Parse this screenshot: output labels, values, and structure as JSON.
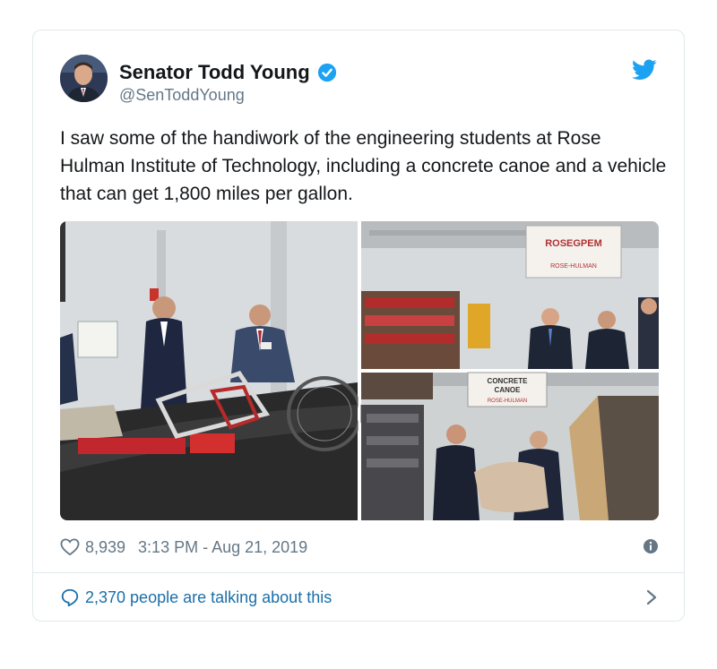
{
  "author": {
    "name": "Senator Todd Young",
    "handle": "@SenToddYoung",
    "verified": true
  },
  "tweet": {
    "text": "I saw some of the handiwork of the engineering students at Rose Hulman Institute of Technology, including a concrete canoe and a vehicle that can get 1,800 miles per gallon."
  },
  "media": {
    "photo_signs": {
      "banner_top_left": "ROSEGPEM",
      "banner_top_sub": "ROSE-HULMAN",
      "concrete_canoe_1": "CONCRETE",
      "concrete_canoe_2": "CANOE",
      "concrete_canoe_sub": "ROSE-HULMAN"
    }
  },
  "meta": {
    "likes": "8,939",
    "timestamp": "3:13 PM - Aug 21, 2019"
  },
  "footer": {
    "talking": "2,370 people are talking about this"
  },
  "colors": {
    "accent": "#1da1f2",
    "link": "#1b6fa8",
    "muted": "#657786",
    "border": "#e1e8ed"
  },
  "icons": [
    "verified-badge-icon",
    "twitter-bird-icon",
    "heart-icon",
    "info-icon",
    "comment-bubble-icon",
    "chevron-right-icon"
  ]
}
